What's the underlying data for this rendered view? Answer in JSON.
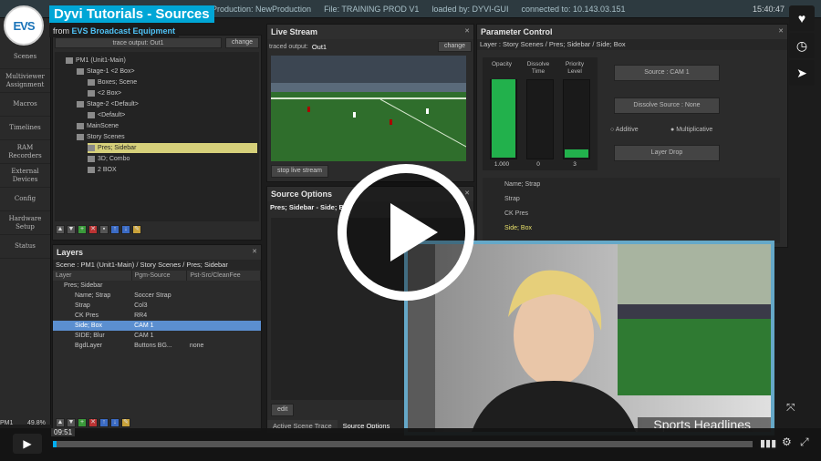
{
  "top_bar": {
    "production": "Production: NewProduction",
    "file": "File: TRAINING PROD V1",
    "loaded": "loaded by: DYVI-GUI",
    "connected": "connected to: 10.143.03.151",
    "clock": "15:40:47"
  },
  "video_title": {
    "logo_text": "EVS",
    "title": "Dyvi Tutorials - Sources",
    "from_prefix": "from",
    "from_link": "EVS Broadcast Equipment"
  },
  "left_nav": [
    "Scenes",
    "Multiviewer Assignment",
    "Macros",
    "Timelines",
    "RAM Recorders",
    "External Devices",
    "Config",
    "Hardware Setup",
    "Status"
  ],
  "scenes_panel": {
    "trace_output": "trace output: Out1",
    "change": "change",
    "tree": [
      {
        "label": "PM1 (Unit1-Main)",
        "depth": 1
      },
      {
        "label": "Stage-1 <2 Box>",
        "depth": 2
      },
      {
        "label": "Boxes; Scene",
        "depth": 3
      },
      {
        "label": "<2 Box>",
        "depth": 3
      },
      {
        "label": "Stage-2 <Default>",
        "depth": 2
      },
      {
        "label": "<Default>",
        "depth": 3
      },
      {
        "label": "MainScene",
        "depth": 2
      },
      {
        "label": "Story Scenes",
        "depth": 2
      },
      {
        "label": "Pres; Sidebar",
        "depth": 3,
        "selected": true
      },
      {
        "label": "3D; Combo",
        "depth": 3
      },
      {
        "label": "2 BOX",
        "depth": 3
      }
    ]
  },
  "layers_panel": {
    "title": "Layers",
    "scene_path": "Scene : PM1 (Unit1-Main) / Story Scenes  / Pres; Sidebar",
    "columns": [
      "Layer",
      "Pgm-Source",
      "Pst-Src/CleanFee"
    ],
    "rows": [
      {
        "layer": "Pres; Sidebar",
        "pgm": "",
        "pst": "",
        "selected": false
      },
      {
        "layer": "Name; Strap",
        "pgm": "Soccer Strap",
        "pst": "",
        "selected": false
      },
      {
        "layer": "Strap",
        "pgm": "Col3",
        "pst": "",
        "selected": false
      },
      {
        "layer": "CK Pres",
        "pgm": "RR4",
        "pst": "",
        "selected": false
      },
      {
        "layer": "Side; Box",
        "pgm": "CAM 1",
        "pst": "",
        "selected": true
      },
      {
        "layer": "SIDE; Blur",
        "pgm": "CAM 1",
        "pst": "",
        "selected": false
      },
      {
        "layer": "BgdLayer",
        "pgm": "Buttons BG...",
        "pst": "none",
        "selected": false
      }
    ]
  },
  "live_stream": {
    "title": "Live Stream",
    "traced_prefix": "traced output:",
    "traced_value": "Out1",
    "change": "change",
    "stop_button": "stop live stream"
  },
  "source_options": {
    "title": "Source Options",
    "path": "Pres; Sidebar - Side; Box",
    "edit": "edit",
    "tab_trace": "Active Scene Trace",
    "tab_options": "Source Options"
  },
  "parameter_control": {
    "title": "Parameter Control",
    "path": "Layer : Story Scenes  / Pres; Sidebar / Side; Box",
    "meters": [
      {
        "label": "Opacity",
        "value": "1.000",
        "fill_fraction": 1.0
      },
      {
        "label": "Dissolve Time",
        "value": "0",
        "fill_fraction": 0.0
      },
      {
        "label": "Priority Level",
        "value": "3",
        "fill_fraction": 0.1
      }
    ],
    "source_button": "Source : CAM 1",
    "dissolve_button": "Dissolve Source : None",
    "additive": "Additive",
    "multiplicative": "Multiplicative",
    "layer_drop": "Layer Drop",
    "layer_list": [
      "Name; Strap",
      "Strap",
      "CK Pres",
      "Side; Box"
    ]
  },
  "overlay": {
    "headline": "Sports Headlines"
  },
  "player": {
    "time": "09:51",
    "status_left": "PM1",
    "status_pct": "49.8%"
  },
  "colors": {
    "accent": "#00a6d6",
    "selected_tree": "#d6d07a",
    "selected_row": "#5b8fd0",
    "meter": "#22b14c",
    "overlay_border": "#65a8c8"
  }
}
